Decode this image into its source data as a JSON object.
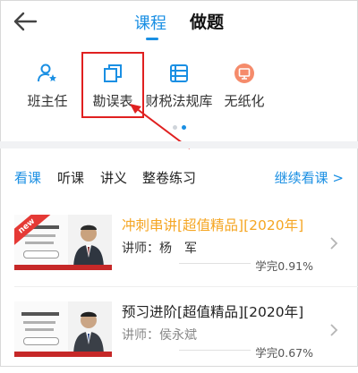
{
  "header": {
    "tabs": [
      {
        "label": "课程",
        "active": true
      },
      {
        "label": "做题",
        "active": false
      }
    ]
  },
  "quick_menu": [
    {
      "label": "班主任",
      "icon": "person-star-icon"
    },
    {
      "label": "勘误表",
      "icon": "copy-icon"
    },
    {
      "label": "财税法规库",
      "icon": "book-shelf-icon"
    },
    {
      "label": "无纸化",
      "icon": "monitor-icon"
    }
  ],
  "sub_tabs": [
    {
      "label": "看课",
      "active": true
    },
    {
      "label": "听课",
      "active": false
    },
    {
      "label": "讲义",
      "active": false
    },
    {
      "label": "整卷练习",
      "active": false
    }
  ],
  "continue_label": "继续看课 >",
  "courses": [
    {
      "title": "冲刺串讲[超值精品][2020年]",
      "teacher": "讲师：杨　军",
      "progress": "学完0.91%",
      "badge": "new",
      "title_color": "#f5a623"
    },
    {
      "title": "预习进阶[超值精品][2020年]",
      "teacher": "讲师：侯永斌",
      "progress": "学完0.67%",
      "badge": "",
      "title_color": "#222222"
    }
  ],
  "colors": {
    "accent": "#1a8fe3",
    "highlight_box": "#e02020"
  }
}
